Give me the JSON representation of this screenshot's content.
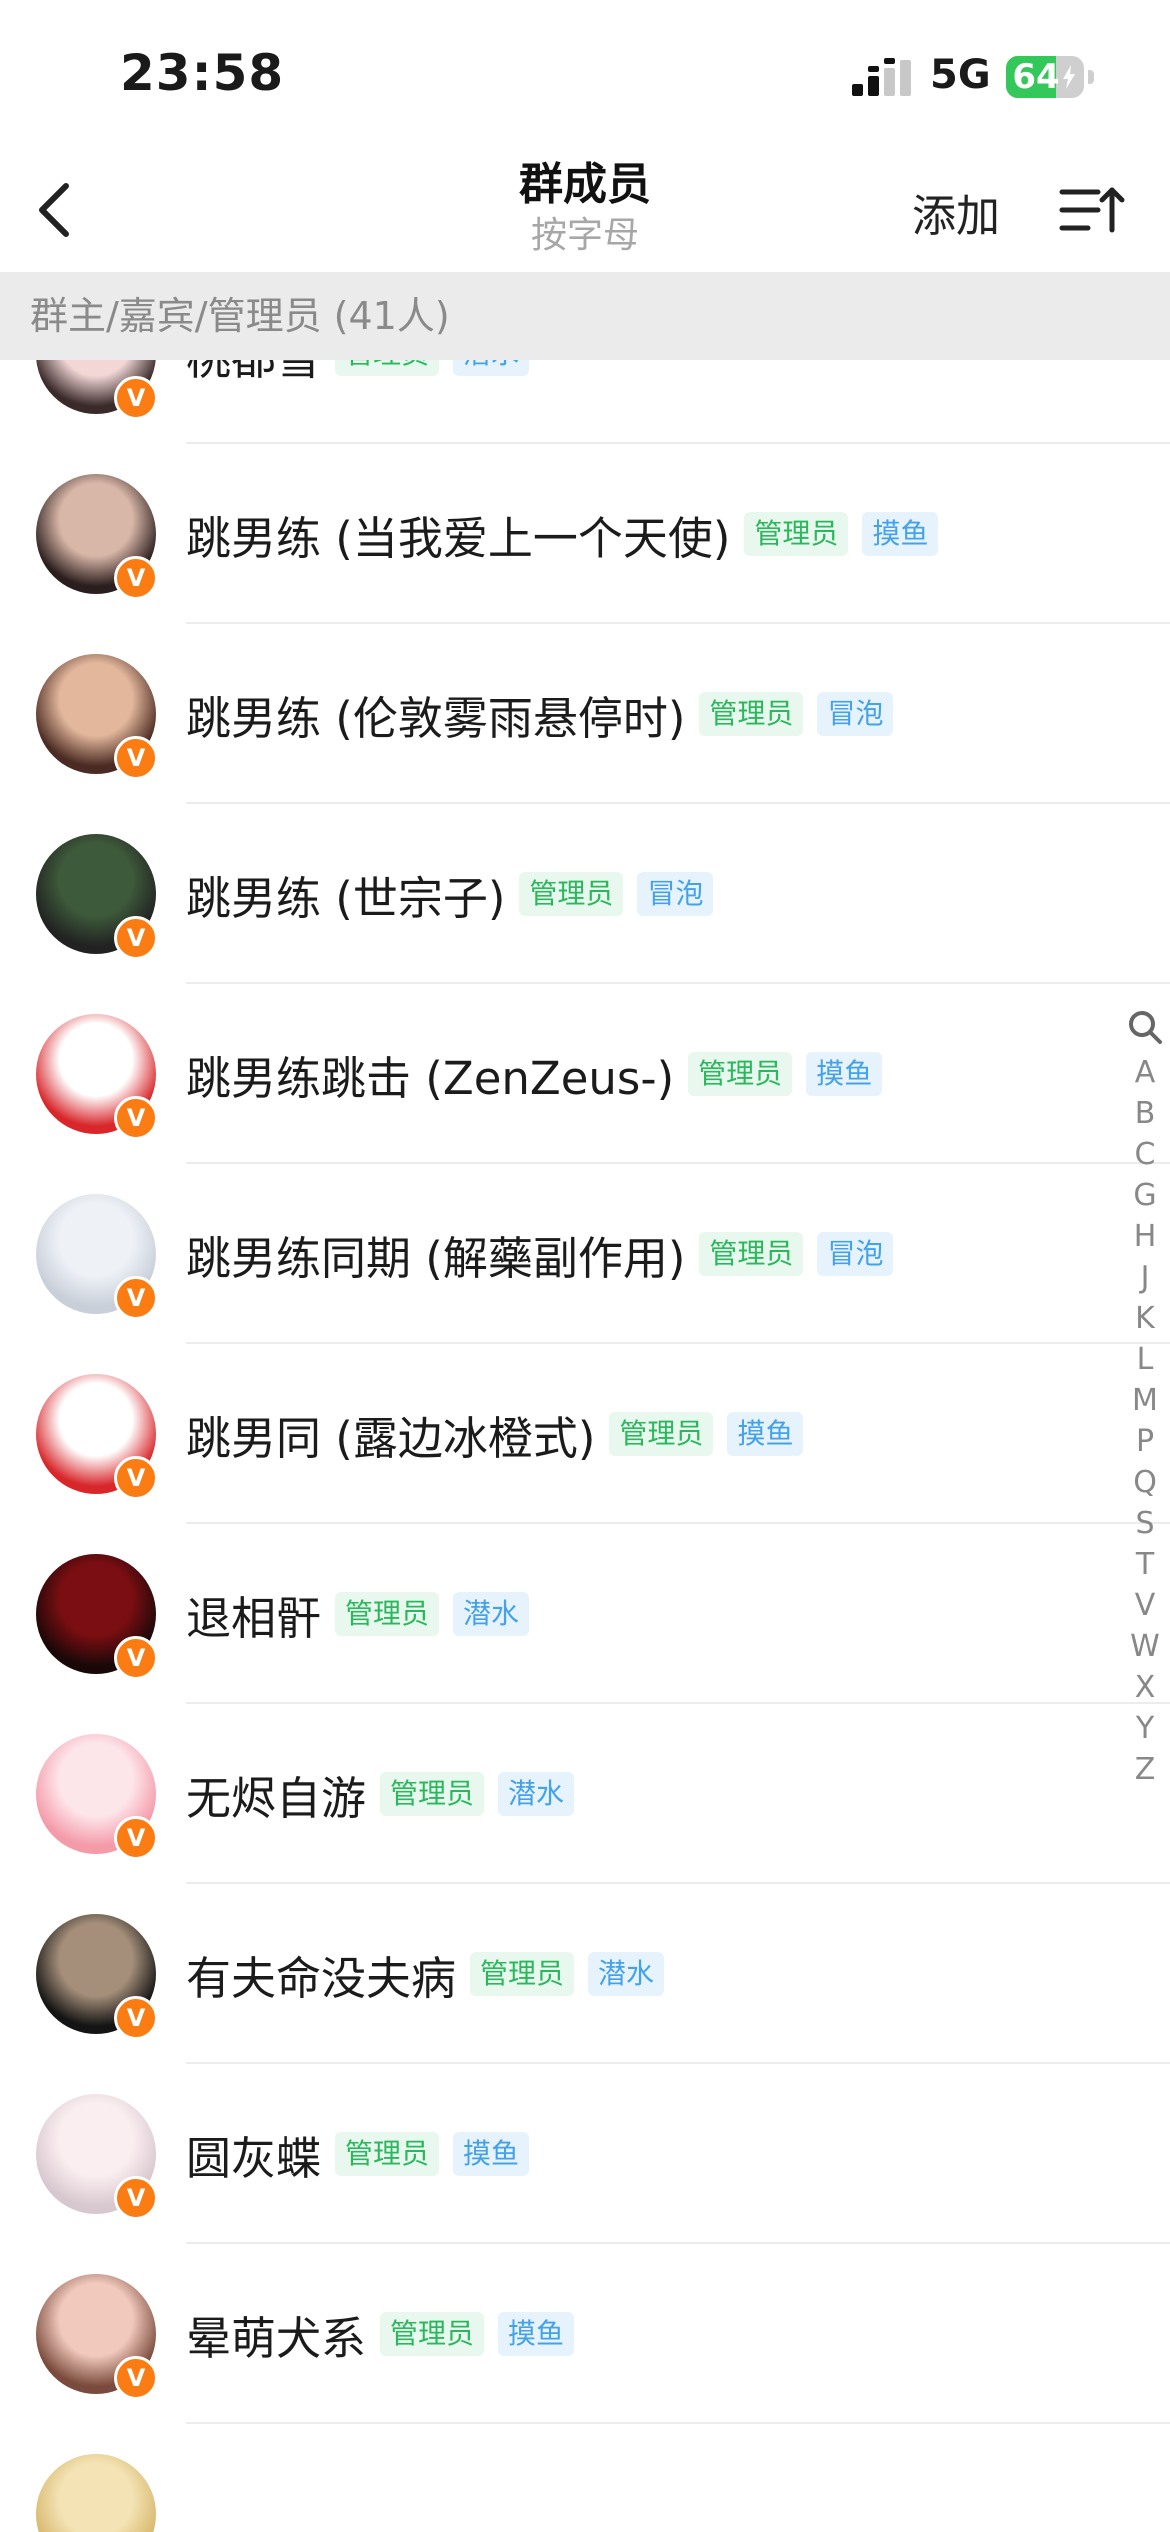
{
  "status": {
    "time": "23:58",
    "network": "5G",
    "battery": "64",
    "battery_level": 0.64
  },
  "nav": {
    "title": "群成员",
    "subtitle": "按字母",
    "add_label": "添加"
  },
  "section": {
    "header": "群主/嘉宾/管理员 (41人)"
  },
  "members": [
    {
      "name": "桃都雪",
      "role": "管理员",
      "level": "潜水",
      "avatar_colors": [
        "#f3d7d7",
        "#3a2a2a"
      ]
    },
    {
      "name": "跳男练 (当我爱上一个天使)",
      "role": "管理员",
      "level": "摸鱼",
      "avatar_colors": [
        "#d9b7a8",
        "#2b1e1e"
      ]
    },
    {
      "name": "跳男练 (伦敦雾雨悬停时)",
      "role": "管理员",
      "level": "冒泡",
      "avatar_colors": [
        "#e2b79c",
        "#4a2a22"
      ]
    },
    {
      "name": "跳男练 (世宗子)",
      "role": "管理员",
      "level": "冒泡",
      "avatar_colors": [
        "#3d5a3a",
        "#222222"
      ]
    },
    {
      "name": "跳男练跳击 (ZenZeus-)",
      "role": "管理员",
      "level": "摸鱼",
      "avatar_colors": [
        "#ffffff",
        "#d8262a"
      ]
    },
    {
      "name": "跳男练同期 (解藥副作用)",
      "role": "管理员",
      "level": "冒泡",
      "avatar_colors": [
        "#eef2f7",
        "#c9cfd9"
      ]
    },
    {
      "name": "跳男同 (露边冰橙式)",
      "role": "管理员",
      "level": "摸鱼",
      "avatar_colors": [
        "#ffffff",
        "#d8262a"
      ]
    },
    {
      "name": "退相骭",
      "role": "管理员",
      "level": "潜水",
      "avatar_colors": [
        "#7a0e12",
        "#1a0808"
      ]
    },
    {
      "name": "无烬自游",
      "role": "管理员",
      "level": "潜水",
      "avatar_colors": [
        "#fde6ea",
        "#f49aa9"
      ]
    },
    {
      "name": "有夫命没夫病",
      "role": "管理员",
      "level": "潜水",
      "avatar_colors": [
        "#a58f7a",
        "#141414"
      ]
    },
    {
      "name": "圆灰蝶",
      "role": "管理员",
      "level": "摸鱼",
      "avatar_colors": [
        "#fbeef0",
        "#d7c8cf"
      ]
    },
    {
      "name": "晕萌犬系",
      "role": "管理员",
      "level": "摸鱼",
      "avatar_colors": [
        "#f1c9bd",
        "#7a4b3c"
      ]
    },
    {
      "name": "",
      "role": "",
      "level": "",
      "avatar_colors": [
        "#f3e3b5",
        "#d7b66a"
      ]
    }
  ],
  "badge_letter": "V",
  "index_letters": [
    "A",
    "B",
    "C",
    "G",
    "H",
    "J",
    "K",
    "L",
    "M",
    "P",
    "Q",
    "S",
    "T",
    "V",
    "W",
    "X",
    "Y",
    "Z"
  ],
  "colors": {
    "admin_tag_text": "#2ab85c",
    "level_tag_text": "#43a2e8",
    "vip_badge": "#fa7c12"
  }
}
